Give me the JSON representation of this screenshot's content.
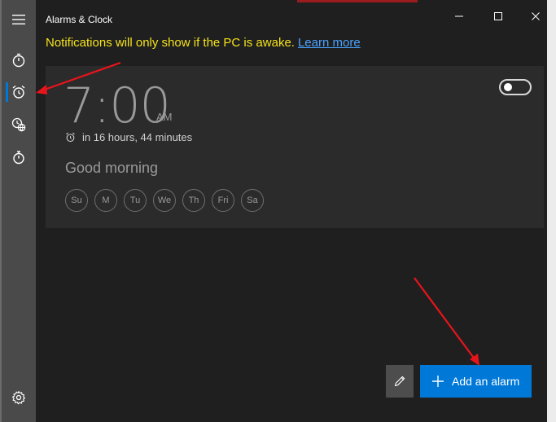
{
  "window": {
    "title": "Alarms & Clock"
  },
  "nav": {
    "items": [
      {
        "name": "timer",
        "icon": "timer-icon"
      },
      {
        "name": "alarm",
        "icon": "alarm-clock-icon",
        "active": true
      },
      {
        "name": "world-clock",
        "icon": "world-clock-icon"
      },
      {
        "name": "stopwatch",
        "icon": "stopwatch-icon"
      },
      {
        "name": "settings",
        "icon": "gear-icon"
      }
    ]
  },
  "notice": {
    "text": "Notifications will only show if the PC is awake.",
    "link": "Learn more"
  },
  "alarm": {
    "time": "7:00",
    "ampm": "AM",
    "countdown": "in 16 hours, 44 minutes",
    "name": "Good morning",
    "days": [
      "Su",
      "M",
      "Tu",
      "We",
      "Th",
      "Fri",
      "Sa"
    ],
    "enabled": false
  },
  "actions": {
    "add_label": "Add an alarm"
  },
  "colors": {
    "accent": "#0078d7",
    "notice": "#f5e31a",
    "link": "#4aa3ff",
    "annotation": "#e8141c"
  }
}
